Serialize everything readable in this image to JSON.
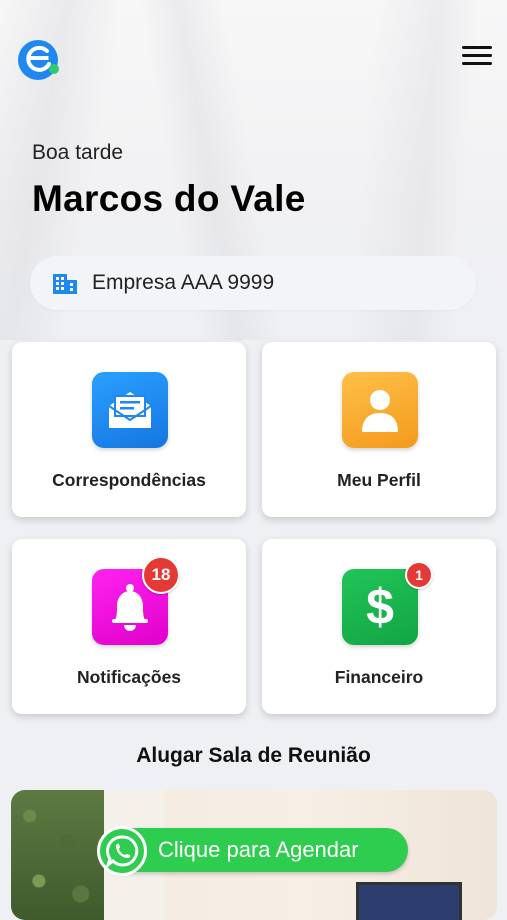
{
  "header": {
    "greeting": "Boa tarde",
    "user_name": "Marcos do Vale"
  },
  "company": {
    "name": "Empresa AAA 9999",
    "icon": "building-icon"
  },
  "menu": [
    {
      "label": "Correspondências",
      "icon": "envelope-icon",
      "color": "#1e88f0"
    },
    {
      "label": "Meu Perfil",
      "icon": "user-icon",
      "color": "#f5a623"
    },
    {
      "label": "Notificações",
      "icon": "bell-icon",
      "color": "#ee00d8",
      "badge": "18"
    },
    {
      "label": "Financeiro",
      "icon": "dollar-icon",
      "color": "#17b34d",
      "badge": "1"
    }
  ],
  "meeting": {
    "title": "Alugar Sala de Reunião",
    "cta_label": "Clique para Agendar"
  },
  "colors": {
    "brand": "#1e88f0",
    "badge": "#e53935",
    "whatsapp": "#2ecc4f"
  }
}
